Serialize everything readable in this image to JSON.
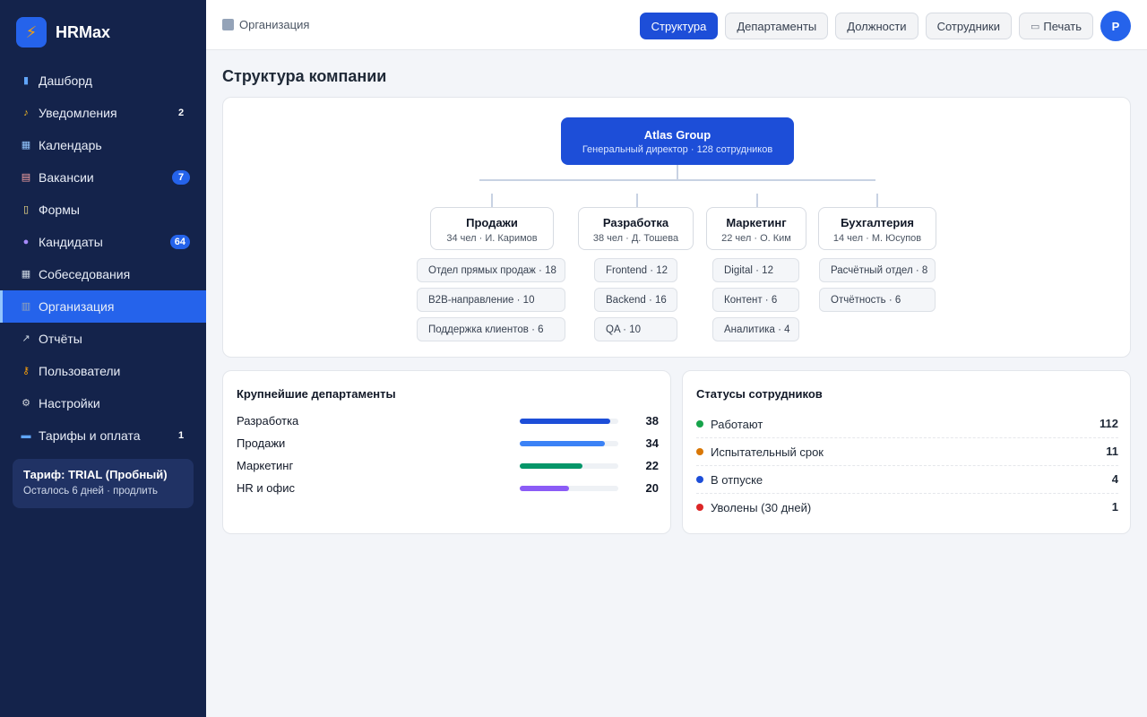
{
  "brand": {
    "name": "HRMax"
  },
  "sidebar": {
    "items": [
      {
        "label": "Дашборд",
        "icon": "chart-icon",
        "color": "#60a5fa",
        "badge": ""
      },
      {
        "label": "Уведомления",
        "icon": "bell-icon",
        "color": "#fbbf24",
        "badge": "2"
      },
      {
        "label": "Календарь",
        "icon": "calendar-icon",
        "color": "#93c5fd",
        "badge": ""
      },
      {
        "label": "Вакансии",
        "icon": "clipboard-icon",
        "color": "#fca5a5",
        "badge": "7"
      },
      {
        "label": "Формы",
        "icon": "document-icon",
        "color": "#fde68a",
        "badge": ""
      },
      {
        "label": "Кандидаты",
        "icon": "person-icon",
        "color": "#a78bfa",
        "badge": "64"
      },
      {
        "label": "Собеседования",
        "icon": "calendar-icon",
        "color": "#cbd5e1",
        "badge": ""
      },
      {
        "label": "Организация",
        "icon": "building-icon",
        "color": "#94a3b8",
        "badge": ""
      },
      {
        "label": "Отчёты",
        "icon": "trend-icon",
        "color": "#cbd5e1",
        "badge": ""
      },
      {
        "label": "Пользователи",
        "icon": "key-icon",
        "color": "#f59e0b",
        "badge": ""
      },
      {
        "label": "Настройки",
        "icon": "gear-icon",
        "color": "#d1d5db",
        "badge": ""
      },
      {
        "label": "Тарифы и оплата",
        "icon": "card-icon",
        "color": "#60a5fa",
        "badge": "1"
      }
    ],
    "active_index": 7,
    "plan": {
      "title": "Тариф: TRIAL (Пробный)",
      "subtitle": "Осталось 6 дней · продлить"
    }
  },
  "topbar": {
    "breadcrumb": "Организация",
    "tabs": [
      "Структура",
      "Департаменты",
      "Должности",
      "Сотрудники"
    ],
    "active_tab": 0,
    "print_label": "Печать",
    "avatar_initial": "P"
  },
  "page": {
    "title": "Структура компании"
  },
  "org": {
    "root": {
      "title": "Atlas Group",
      "subtitle": "Генеральный директор · 128 сотрудников"
    },
    "departments": [
      {
        "title": "Продажи",
        "subtitle": "34 чел · И. Каримов",
        "units": [
          "Отдел прямых продаж · 18",
          "B2B-направление · 10",
          "Поддержка клиентов · 6"
        ]
      },
      {
        "title": "Разработка",
        "subtitle": "38 чел · Д. Тошева",
        "units": [
          "Frontend · 12",
          "Backend · 16",
          "QA · 10"
        ]
      },
      {
        "title": "Маркетинг",
        "subtitle": "22 чел · О. Ким",
        "units": [
          "Digital · 12",
          "Контент · 6",
          "Аналитика · 4"
        ]
      },
      {
        "title": "Бухгалтерия",
        "subtitle": "14 чел · М. Юсупов",
        "units": [
          "Расчётный отдел · 8",
          "Отчётность · 6"
        ]
      }
    ]
  },
  "largest_departments": {
    "title": "Крупнейшие департаменты",
    "rows": [
      {
        "name": "Разработка",
        "value": "38",
        "fraction": 0.92,
        "color": "#1d4ed8"
      },
      {
        "name": "Продажи",
        "value": "34",
        "fraction": 0.86,
        "color": "#3b82f6"
      },
      {
        "name": "Маркетинг",
        "value": "22",
        "fraction": 0.64,
        "color": "#059669"
      },
      {
        "name": "HR и офис",
        "value": "20",
        "fraction": 0.5,
        "color": "#8b5cf6"
      }
    ]
  },
  "employee_statuses": {
    "title": "Статусы сотрудников",
    "rows": [
      {
        "label": "Работают",
        "value": "112",
        "color": "#16a34a"
      },
      {
        "label": "Испытательный срок",
        "value": "11",
        "color": "#d97706"
      },
      {
        "label": "В отпуске",
        "value": "4",
        "color": "#1d4ed8"
      },
      {
        "label": "Уволены (30 дней)",
        "value": "1",
        "color": "#dc2626"
      }
    ]
  }
}
